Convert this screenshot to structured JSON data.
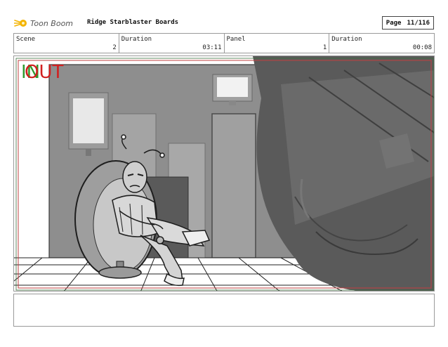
{
  "header": {
    "brand": "Toon Boom",
    "project_title": "Ridge Starblaster Boards",
    "page_label": "Page",
    "page_value": "11/116"
  },
  "info": {
    "scene_label": "Scene",
    "scene_value": "2",
    "scene_duration_label": "Duration",
    "scene_duration_value": "03:11",
    "panel_label": "Panel",
    "panel_value": "1",
    "panel_duration_label": "Duration",
    "panel_duration_value": "00:08"
  },
  "panel": {
    "in_marker": "IN",
    "out_marker": "OUT"
  },
  "notes": {
    "text": ""
  },
  "colors": {
    "in_marker": "#2f9a2f",
    "out_marker": "#d11f1f",
    "frame_line": "#c24040",
    "border": "#9a9a9a"
  },
  "icons": {
    "brand_logo": "toon-boom-logo-icon"
  }
}
